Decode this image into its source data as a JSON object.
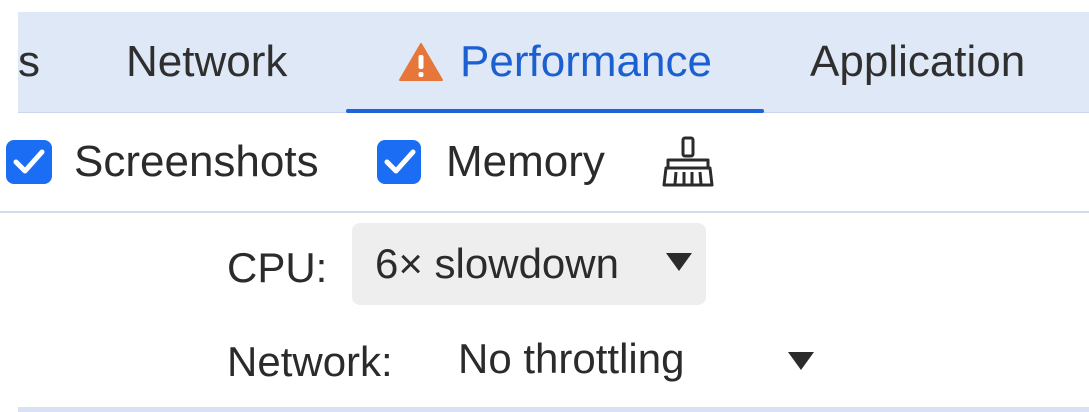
{
  "tabs": {
    "partial_label": "s",
    "network_label": "Network",
    "performance_label": "Performance",
    "application_label": "Application",
    "active": "Performance",
    "warning_icon": "warning-triangle-icon"
  },
  "toolbar": {
    "screenshots": {
      "label": "Screenshots",
      "checked": true
    },
    "memory": {
      "label": "Memory",
      "checked": true
    },
    "gc_icon": "broom-icon"
  },
  "settings": {
    "cpu_label": "CPU:",
    "cpu_value": "6× slowdown",
    "network_label": "Network:",
    "network_value": "No throttling"
  },
  "colors": {
    "tab_bar_bg": "#dfe8f7",
    "accent": "#1b64da",
    "checkbox": "#1b6ef3",
    "warning": "#e6763a"
  }
}
